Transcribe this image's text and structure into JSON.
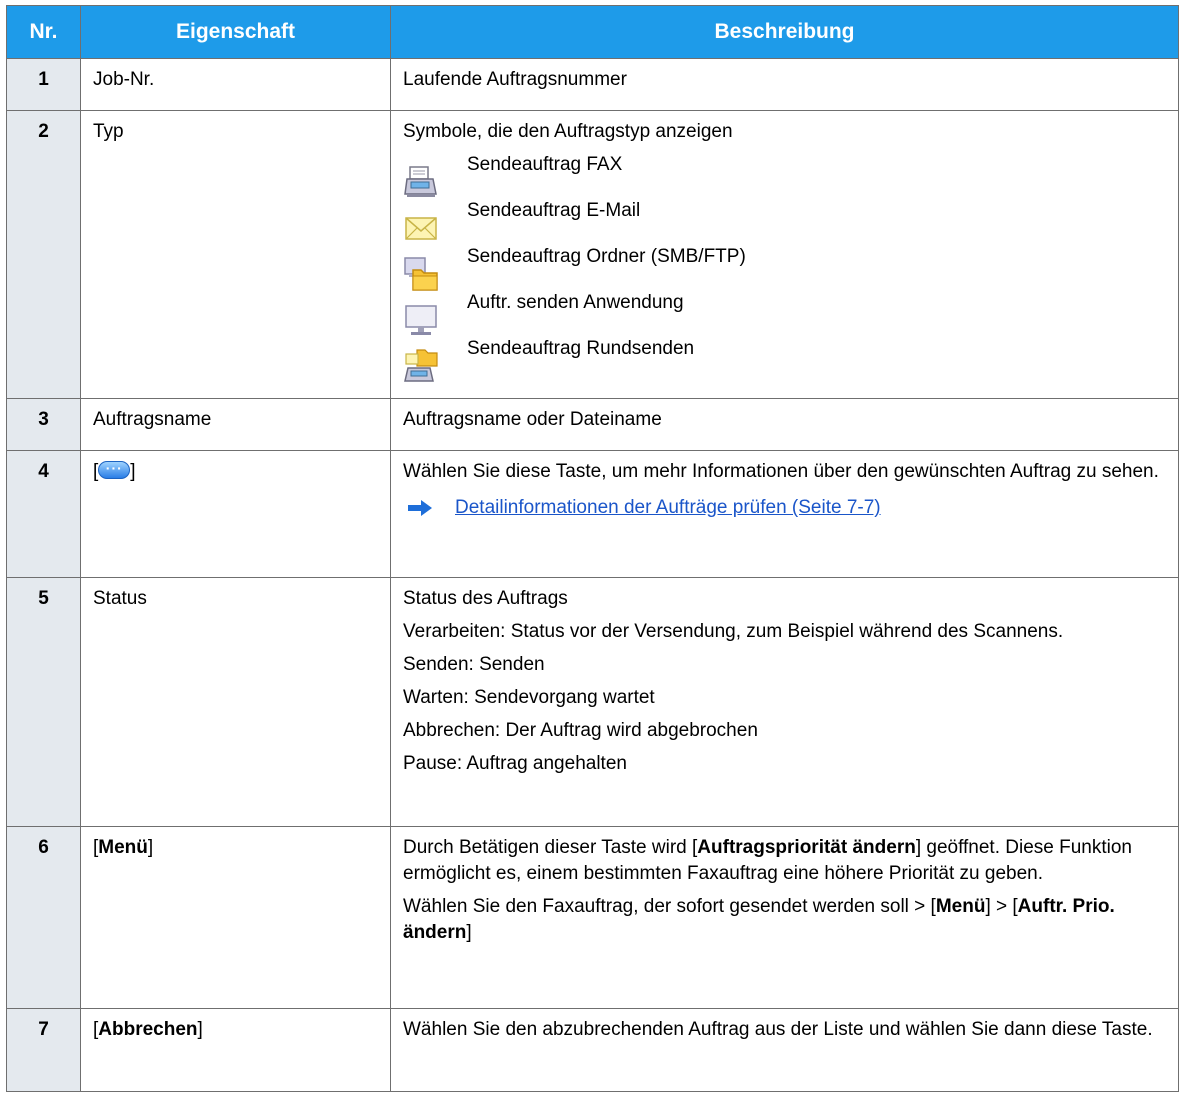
{
  "headers": {
    "nr": "Nr.",
    "property": "Eigenschaft",
    "description": "Beschreibung"
  },
  "rows": [
    {
      "nr": "1",
      "property": "Job-Nr.",
      "desc": "Laufende Auftragsnummer"
    },
    {
      "nr": "2",
      "property": "Typ",
      "desc": "Symbole, die den Auftragstyp anzeigen",
      "types": [
        {
          "icon": "fax-icon",
          "label": "Sendeauftrag FAX"
        },
        {
          "icon": "email-envelope-icon",
          "label": "Sendeauftrag E-Mail"
        },
        {
          "icon": "folder-icon",
          "label": "Sendeauftrag Ordner (SMB/FTP)"
        },
        {
          "icon": "monitor-icon",
          "label": "Auftr. senden Anwendung"
        },
        {
          "icon": "broadcast-icon",
          "label": "Sendeauftrag Rundsenden"
        }
      ]
    },
    {
      "nr": "3",
      "property": "Auftragsname",
      "desc": "Auftragsname oder Dateiname"
    },
    {
      "nr": "4",
      "property_open": "[",
      "property_close": "]",
      "desc": "Wählen Sie diese Taste, um mehr Informationen über den gewünschten Auftrag zu sehen.",
      "link": "Detailinformationen der Aufträge prüfen (Seite 7-7)"
    },
    {
      "nr": "5",
      "property": "Status",
      "lines": [
        "Status des Auftrags",
        "Verarbeiten: Status vor der Versendung, zum Beispiel während des Scannens.",
        "Senden: Senden",
        "Warten: Sendevorgang wartet",
        "Abbrechen: Der Auftrag wird abgebrochen",
        "Pause: Auftrag angehalten"
      ]
    },
    {
      "nr": "6",
      "property_open": "[",
      "property_bold": "Menü",
      "property_close": "]",
      "p1_a": "Durch Betätigen dieser Taste wird [",
      "p1_b": "Auftragspriorität ändern",
      "p1_c": "] geöffnet. Diese Funktion ermöglicht es, einem bestimmten Faxauftrag eine höhere Priorität zu geben.",
      "p2_a": "Wählen Sie den Faxauftrag, der sofort gesendet werden soll > [",
      "p2_b": "Menü",
      "p2_c": "] > [",
      "p2_d": "Auftr. Prio. ändern",
      "p2_e": "]"
    },
    {
      "nr": "7",
      "property_open": "[",
      "property_bold": "Abbrechen",
      "property_close": "]",
      "desc": "Wählen Sie den abzubrechenden Auftrag aus der Liste und wählen Sie dann diese Taste."
    }
  ]
}
